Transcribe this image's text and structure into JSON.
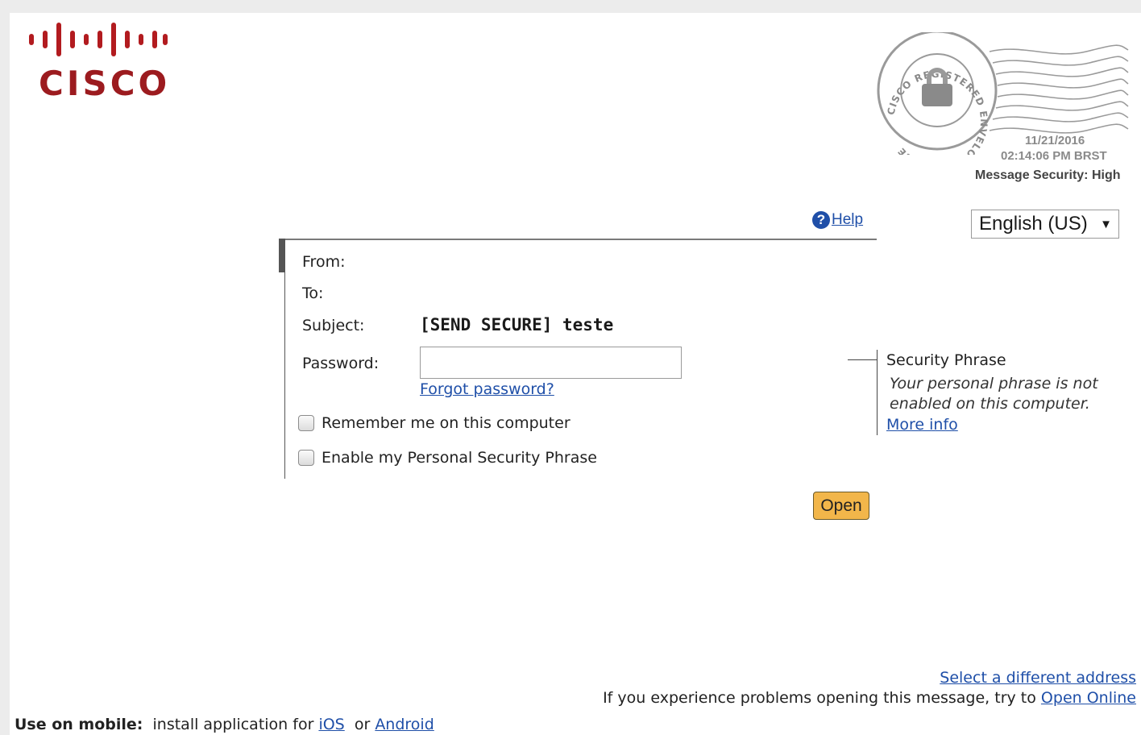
{
  "brand": {
    "logo_text": "CISCO",
    "color": "#b21b1f"
  },
  "stamp": {
    "ring_text": "CISCO REGISTERED ENVELOPE SERVICE",
    "date": "11/21/2016",
    "time": "02:14:06 PM BRST",
    "security_label": "Message Security:",
    "security_value": "High",
    "icon": "lock-icon"
  },
  "header": {
    "help_label": "Help",
    "help_icon": "question-icon",
    "language": "English (US)"
  },
  "form": {
    "from_label": "From:",
    "from_value": "",
    "to_label": "To:",
    "to_value": "",
    "subject_label": "Subject:",
    "subject_value": "[SEND SECURE] teste",
    "password_label": "Password:",
    "password_value": "",
    "forgot_label": "Forgot password?",
    "remember_label": "Remember me on this computer",
    "enable_phrase_label": "Enable my Personal Security Phrase",
    "open_label": "Open"
  },
  "security_phrase": {
    "title": "Security Phrase",
    "text": "Your personal phrase is not enabled on this computer.",
    "more_info": "More info"
  },
  "footer": {
    "select_address": "Select a different address",
    "problems_text": "If you experience problems opening this message, try to ",
    "open_online": "Open Online",
    "mobile_label": "Use on mobile:",
    "mobile_text": "install application for",
    "ios": "iOS",
    "or": "or",
    "android": "Android"
  },
  "colors": {
    "link": "#1f4fa8",
    "button": "#f2b64a",
    "logo": "#9c1b1f"
  }
}
